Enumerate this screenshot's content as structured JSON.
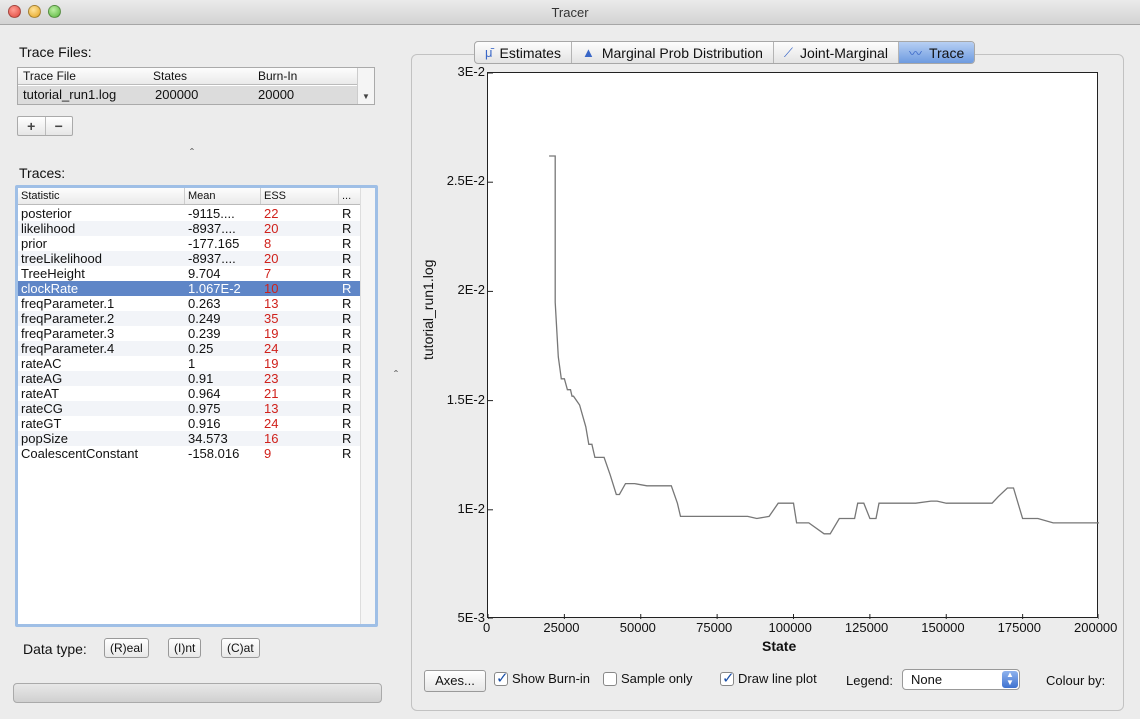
{
  "window": {
    "title": "Tracer"
  },
  "trace_files": {
    "label": "Trace Files:",
    "columns": [
      "Trace File",
      "States",
      "Burn-In"
    ],
    "rows": [
      {
        "file": "tutorial_run1.log",
        "states": "200000",
        "burnin": "20000"
      }
    ],
    "add_label": "+",
    "remove_label": "−"
  },
  "traces": {
    "label": "Traces:",
    "columns": [
      "Statistic",
      "Mean",
      "ESS",
      "..."
    ],
    "rows": [
      {
        "name": "posterior",
        "mean": "-9115....",
        "ess": "22",
        "type": "R"
      },
      {
        "name": "likelihood",
        "mean": "-8937....",
        "ess": "20",
        "type": "R"
      },
      {
        "name": "prior",
        "mean": "-177.165",
        "ess": "8",
        "type": "R"
      },
      {
        "name": "treeLikelihood",
        "mean": "-8937....",
        "ess": "20",
        "type": "R"
      },
      {
        "name": "TreeHeight",
        "mean": "9.704",
        "ess": "7",
        "type": "R"
      },
      {
        "name": "clockRate",
        "mean": "1.067E-2",
        "ess": "10",
        "type": "R"
      },
      {
        "name": "freqParameter.1",
        "mean": "0.263",
        "ess": "13",
        "type": "R"
      },
      {
        "name": "freqParameter.2",
        "mean": "0.249",
        "ess": "35",
        "type": "R"
      },
      {
        "name": "freqParameter.3",
        "mean": "0.239",
        "ess": "19",
        "type": "R"
      },
      {
        "name": "freqParameter.4",
        "mean": "0.25",
        "ess": "24",
        "type": "R"
      },
      {
        "name": "rateAC",
        "mean": "1",
        "ess": "19",
        "type": "R"
      },
      {
        "name": "rateAG",
        "mean": "0.91",
        "ess": "23",
        "type": "R"
      },
      {
        "name": "rateAT",
        "mean": "0.964",
        "ess": "21",
        "type": "R"
      },
      {
        "name": "rateCG",
        "mean": "0.975",
        "ess": "13",
        "type": "R"
      },
      {
        "name": "rateGT",
        "mean": "0.916",
        "ess": "24",
        "type": "R"
      },
      {
        "name": "popSize",
        "mean": "34.573",
        "ess": "16",
        "type": "R"
      },
      {
        "name": "CoalescentConstant",
        "mean": "-158.016",
        "ess": "9",
        "type": "R"
      }
    ],
    "selected": "clockRate"
  },
  "data_type": {
    "label": "Data type:",
    "real": "(R)eal",
    "int": "(I)nt",
    "cat": "(C)at"
  },
  "tabs": [
    "Estimates",
    "Marginal Prob Distribution",
    "Joint-Marginal",
    "Trace"
  ],
  "active_tab": "Trace",
  "controls": {
    "axes": "Axes...",
    "show_burnin": "Show Burn-in",
    "sample_only": "Sample only",
    "draw_line": "Draw line plot",
    "legend_label": "Legend:",
    "legend_value": "None",
    "colour_by": "Colour by:"
  },
  "chart_data": {
    "type": "line",
    "xlabel": "State",
    "ylabel": "tutorial_run1.log",
    "xlim": [
      0,
      200000
    ],
    "ylim": [
      0.005,
      0.03
    ],
    "x_ticks": [
      "0",
      "25000",
      "50000",
      "75000",
      "100000",
      "125000",
      "150000",
      "175000",
      "200000"
    ],
    "y_ticks": [
      "5E-3",
      "1E-2",
      "1.5E-2",
      "2E-2",
      "2.5E-2",
      "3E-2"
    ],
    "x": [
      20000,
      22000,
      22000,
      23000,
      23500,
      24000,
      25000,
      26000,
      27000,
      27500,
      28000,
      30000,
      31000,
      32000,
      33000,
      34000,
      35000,
      36000,
      38000,
      40000,
      42000,
      43000,
      45000,
      48000,
      52000,
      55000,
      60000,
      62000,
      63000,
      68000,
      75000,
      80000,
      85000,
      88000,
      92000,
      95000,
      97000,
      100000,
      101000,
      105000,
      110000,
      112000,
      115000,
      120000,
      121000,
      123000,
      125000,
      127000,
      128000,
      130000,
      140000,
      145000,
      147000,
      150000,
      160000,
      165000,
      167000,
      170000,
      172000,
      175000,
      180000,
      185000,
      200000
    ],
    "y": [
      0.0262,
      0.0262,
      0.0195,
      0.017,
      0.0165,
      0.016,
      0.016,
      0.0155,
      0.0155,
      0.0152,
      0.0152,
      0.0148,
      0.0143,
      0.0138,
      0.013,
      0.013,
      0.0124,
      0.0124,
      0.0124,
      0.0116,
      0.0107,
      0.0107,
      0.0112,
      0.0112,
      0.0111,
      0.0111,
      0.0111,
      0.0103,
      0.0097,
      0.0097,
      0.0097,
      0.0097,
      0.0097,
      0.0096,
      0.0097,
      0.0103,
      0.0103,
      0.0103,
      0.0094,
      0.0094,
      0.0089,
      0.0089,
      0.0096,
      0.0096,
      0.0103,
      0.0103,
      0.0096,
      0.0096,
      0.0103,
      0.0103,
      0.0103,
      0.0104,
      0.0104,
      0.0103,
      0.0103,
      0.0103,
      0.0106,
      0.011,
      0.011,
      0.0096,
      0.0096,
      0.0094,
      0.0094
    ],
    "grid": false,
    "line_color": "#777777"
  }
}
